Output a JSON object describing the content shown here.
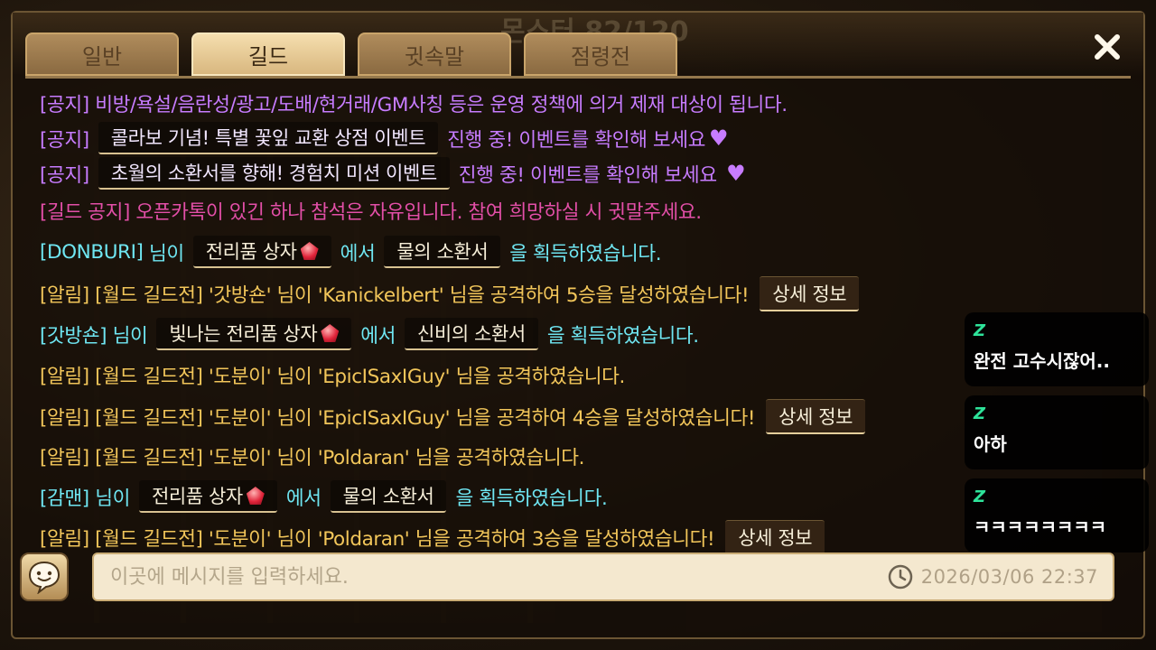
{
  "window": {
    "background_title": "몬스터 82/120"
  },
  "tabs": [
    {
      "label": "일반",
      "active": false
    },
    {
      "label": "길드",
      "active": true
    },
    {
      "label": "귓속말",
      "active": false
    },
    {
      "label": "점령전",
      "active": false
    }
  ],
  "chat": {
    "lines": [
      {
        "prefix": "[공지]",
        "text": "비방/욕설/음란성/광고/도배/현거래/GM사칭 등은 운영 정책에 의거 제재 대상이 됩니다."
      },
      {
        "prefix": "[공지]",
        "pill": "콜라보 기념! 특별 꽃잎 교환 상점 이벤트",
        "text": "진행 중! 이벤트를 확인해 보세요",
        "heart": "♥"
      },
      {
        "prefix": "[공지]",
        "pill": "초월의 소환서를 향해! 경험치 미션 이벤트",
        "text": "진행 중! 이벤트를 확인해 보세요",
        "heart": "♥"
      },
      {
        "text": "[길드 공지] 오픈카톡이 있긴 하나 참석은 자유입니다. 참여 희망하실 시 귓말주세요."
      },
      {
        "name": "[DONBURI]",
        "t1": "님이",
        "item1": "전리품 상자",
        "t2": "에서",
        "item2": "물의 소환서",
        "t3": "을 획득하였습니다."
      },
      {
        "text": "[알림] [월드 길드전] '갓방숀' 님이 'Kanickelbert' 님을 공격하여 5승을 달성하였습니다!",
        "button": "상세 정보"
      },
      {
        "name": "[갓방숀]",
        "t1": "님이",
        "item1": "빛나는 전리품 상자",
        "t2": "에서",
        "item2": "신비의 소환서",
        "t3": "을 획득하였습니다."
      },
      {
        "text": "[알림] [월드 길드전] '도분이' 님이 'EpicISaxIGuy' 님을 공격하였습니다."
      },
      {
        "text": "[알림] [월드 길드전] '도분이' 님이 'EpicISaxIGuy' 님을 공격하여 4승을 달성하였습니다!",
        "button": "상세 정보"
      },
      {
        "text": "[알림] [월드 길드전] '도분이' 님이 'Poldaran' 님을 공격하였습니다."
      },
      {
        "name": "[감맨]",
        "t1": "님이",
        "item1": "전리품 상자",
        "t2": "에서",
        "item2": "물의 소환서",
        "t3": "을 획득하였습니다."
      },
      {
        "text": "[알림] [월드 길드전] '도분이' 님이 'Poldaran' 님을 공격하여 3승을 달성하였습니다!",
        "button": "상세 정보"
      }
    ]
  },
  "input": {
    "placeholder": "이곳에 메시지를 입력하세요.",
    "timestamp": "2026/03/06  22:37"
  },
  "overlay_chat": [
    {
      "badge": "Z",
      "message": "완전 고수시잖어.."
    },
    {
      "badge": "Z",
      "message": "아하"
    },
    {
      "badge": "Z",
      "message": "ㅋㅋㅋㅋㅋㅋㅋㅋ"
    }
  ],
  "colors": {
    "notice": "#c77cff",
    "guild_notice": "#e34fa8",
    "loot": "#6fe6f2",
    "alert": "#f2c65a"
  },
  "icons": [
    "close-icon",
    "smiley-icon",
    "clock-icon",
    "gem-icon",
    "heart-icon"
  ]
}
